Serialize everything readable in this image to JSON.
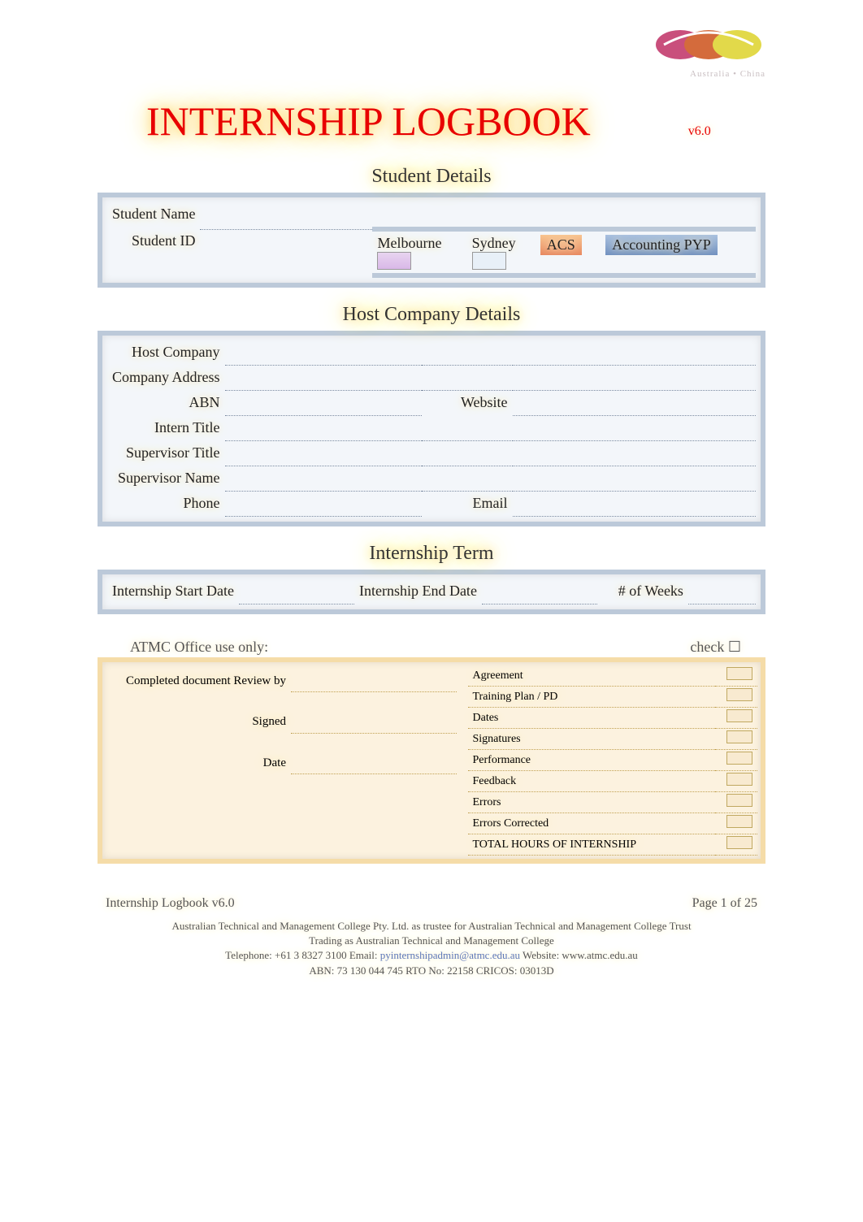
{
  "header": {
    "logo_subtext": "Australia • China"
  },
  "title": "INTERNSHIP LOGBOOK",
  "version": "v6.0",
  "sections": {
    "student": {
      "heading": "Student Details",
      "labels": {
        "student_name": "Student Name",
        "student_id": "Student ID",
        "melbourne": "Melbourne",
        "sydney": "Sydney",
        "acs": "ACS",
        "accounting": "Accounting PYP"
      },
      "values": {
        "student_name": "",
        "student_id": ""
      }
    },
    "host": {
      "heading": "Host Company Details",
      "labels": {
        "host_company": "Host Company",
        "company_address": "Company Address",
        "abn": "ABN",
        "website": "Website",
        "intern_title": "Intern Title",
        "supervisor_title": "Supervisor Title",
        "supervisor_name": "Supervisor Name",
        "phone": "Phone",
        "email": "Email"
      },
      "values": {
        "host_company": "",
        "company_address": "",
        "abn": "",
        "website": "",
        "intern_title": "",
        "supervisor_title": "",
        "supervisor_name": "",
        "phone": "",
        "email": ""
      }
    },
    "term": {
      "heading": "Internship Term",
      "labels": {
        "start": "Internship Start Date",
        "end": "Internship End Date",
        "weeks": "# of Weeks"
      },
      "values": {
        "start": "",
        "end": "",
        "weeks": ""
      }
    },
    "office": {
      "heading": "ATMC Office use only:",
      "check_label": "check ",
      "labels": {
        "review_by": "Completed document Review by",
        "signed": "Signed",
        "date": "Date"
      },
      "checklist": [
        "Agreement",
        "Training Plan / PD",
        "Dates",
        "Signatures",
        "Performance",
        "Feedback",
        "Errors",
        "Errors Corrected",
        "TOTAL HOURS OF INTERNSHIP"
      ]
    }
  },
  "footer": {
    "left": "Internship Logbook v6.0",
    "right": "Page 1 of 25",
    "line1": "Australian Technical and Management College Pty. Ltd. as trustee for Australian Technical and Management College Trust",
    "line2": "Trading as Australian Technical and Management College",
    "line3a": "Telephone: +61 3 8327 3100 Email: ",
    "line3_email": "pyinternshipadmin@atmc.edu.au",
    "line3b": "    Website: www.atmc.edu.au",
    "line4": "ABN: 73 130 044 745 RTO No: 22158 CRICOS: 03013D"
  }
}
